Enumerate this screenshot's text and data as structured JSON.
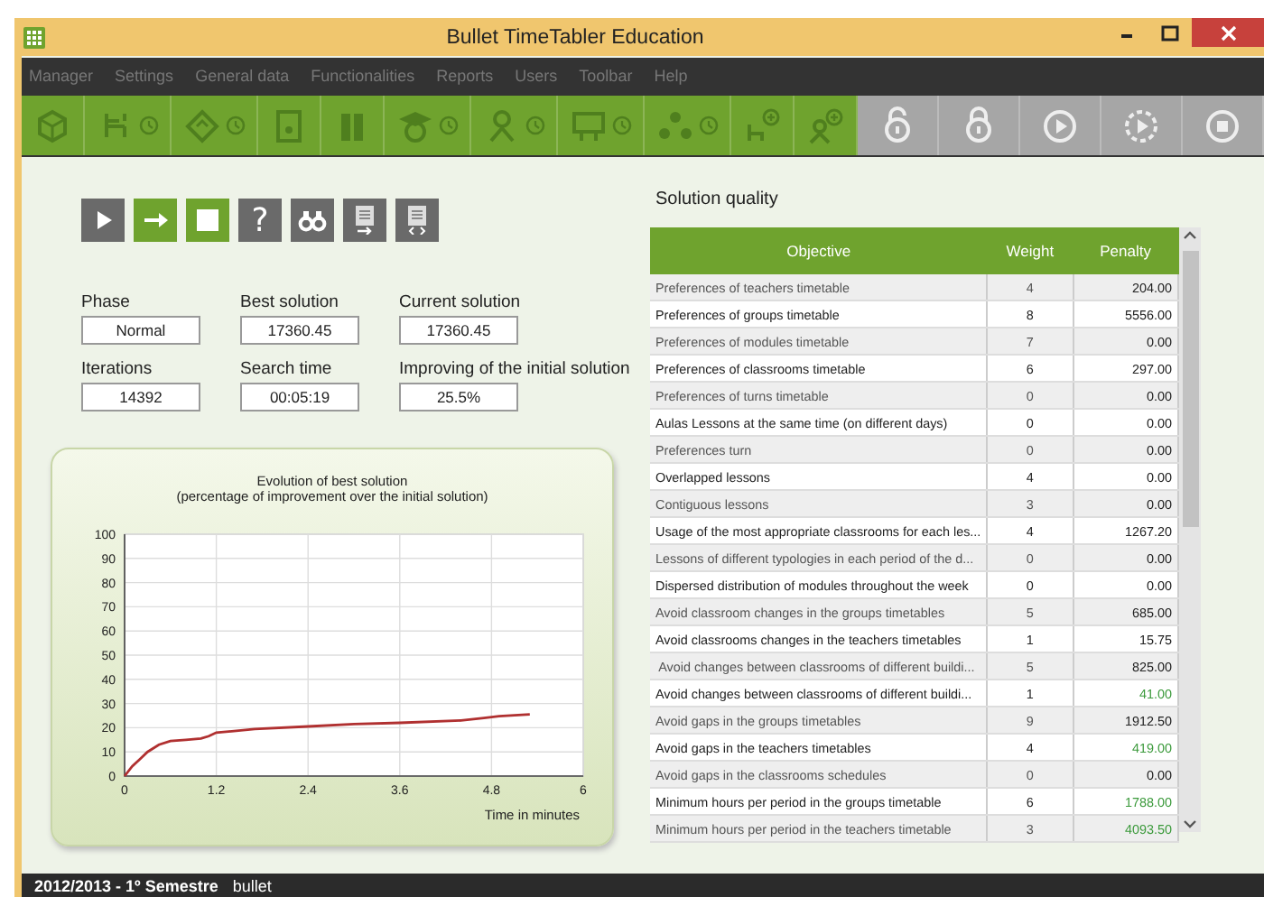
{
  "window": {
    "title": "Bullet TimeTabler Education"
  },
  "menu": [
    "Manager",
    "Settings",
    "General data",
    "Functionalities",
    "Reports",
    "Users",
    "Toolbar",
    "Help"
  ],
  "toolbar": [
    {
      "kind": "cube",
      "clock": false,
      "disabled": false
    },
    {
      "kind": "chair",
      "clock": true,
      "disabled": false
    },
    {
      "kind": "book",
      "clock": true,
      "disabled": false
    },
    {
      "kind": "certificate",
      "clock": false,
      "disabled": false
    },
    {
      "kind": "books",
      "clock": false,
      "disabled": false
    },
    {
      "kind": "graduate",
      "clock": true,
      "disabled": false
    },
    {
      "kind": "teacher",
      "clock": true,
      "disabled": false
    },
    {
      "kind": "board",
      "clock": true,
      "disabled": false
    },
    {
      "kind": "group",
      "clock": true,
      "disabled": false
    },
    {
      "kind": "add-chair",
      "clock": false,
      "disabled": false
    },
    {
      "kind": "add-person",
      "clock": false,
      "disabled": false
    },
    {
      "kind": "unlock",
      "clock": false,
      "disabled": true
    },
    {
      "kind": "lock",
      "clock": false,
      "disabled": true
    },
    {
      "kind": "play",
      "clock": false,
      "disabled": true
    },
    {
      "kind": "play-dashed",
      "clock": false,
      "disabled": true
    },
    {
      "kind": "stop",
      "clock": false,
      "disabled": true
    }
  ],
  "controls": [
    {
      "kind": "play",
      "active": false
    },
    {
      "kind": "arrow",
      "active": true
    },
    {
      "kind": "stop",
      "active": true
    },
    {
      "kind": "text",
      "label": "?",
      "active": false
    },
    {
      "kind": "binoculars",
      "active": false
    },
    {
      "kind": "export",
      "active": false
    },
    {
      "kind": "code",
      "active": false
    }
  ],
  "fields": [
    {
      "label": "Phase",
      "value": "Normal"
    },
    {
      "label": "Best solution",
      "value": "17360.45"
    },
    {
      "label": "Current solution",
      "value": "17360.45"
    },
    {
      "label": "Iterations",
      "value": "14392"
    },
    {
      "label": "Search time",
      "value": "00:05:19"
    },
    {
      "label": "Improving of the initial solution",
      "value": "25.5%"
    }
  ],
  "chart": {
    "chart_data": {
      "type": "line",
      "title": "Evolution of best solution\n(percentage of improvement over the initial solution)",
      "xlabel": "Time in minutes",
      "xlim": [
        0,
        6
      ],
      "ylim": [
        0,
        100
      ],
      "xticks": [
        0,
        1.2,
        2.4,
        3.6,
        4.8,
        6
      ],
      "yticks": [
        0,
        10,
        20,
        30,
        40,
        50,
        60,
        70,
        80,
        90,
        100
      ],
      "x": [
        0,
        0.1,
        0.2,
        0.3,
        0.45,
        0.6,
        0.8,
        1.0,
        1.1,
        1.2,
        1.4,
        1.7,
        2.4,
        3.0,
        3.6,
        4.4,
        4.7,
        4.9,
        5.3
      ],
      "grid": true,
      "series": [
        {
          "color": "#b03030",
          "values": [
            0,
            4,
            7,
            10,
            13,
            14.5,
            15,
            15.5,
            16.5,
            18,
            18.5,
            19.5,
            20.5,
            21.5,
            22,
            23,
            24,
            24.8,
            25.5
          ]
        }
      ]
    }
  },
  "quality": {
    "title": "Solution quality",
    "columns": [
      "Objective",
      "Weight",
      "Penalty"
    ],
    "rows": [
      {
        "objective": "Preferences of teachers timetable",
        "weight": "4",
        "penalty": "204.00",
        "color": "#222222"
      },
      {
        "objective": "Preferences of groups timetable",
        "weight": "8",
        "penalty": "5556.00",
        "color": "#222222"
      },
      {
        "objective": "Preferences of modules timetable",
        "weight": "7",
        "penalty": "0.00",
        "color": "#222222"
      },
      {
        "objective": "Preferences of classrooms timetable",
        "weight": "6",
        "penalty": "297.00",
        "color": "#222222"
      },
      {
        "objective": "Preferences of turns timetable",
        "weight": "0",
        "penalty": "0.00",
        "color": "#222222"
      },
      {
        "objective": "Aulas Lessons at the same time (on different days)",
        "weight": "0",
        "penalty": "0.00",
        "color": "#222222"
      },
      {
        "objective": "Preferences turn",
        "weight": "0",
        "penalty": "0.00",
        "color": "#222222"
      },
      {
        "objective": "Overlapped lessons",
        "weight": "4",
        "penalty": "0.00",
        "color": "#222222"
      },
      {
        "objective": "Contiguous lessons",
        "weight": "3",
        "penalty": "0.00",
        "color": "#222222"
      },
      {
        "objective": "Usage of the most appropriate classrooms for each les...",
        "weight": "4",
        "penalty": "1267.20",
        "color": "#222222"
      },
      {
        "objective": "Lessons of different typologies in each period of the d...",
        "weight": "0",
        "penalty": "0.00",
        "color": "#222222"
      },
      {
        "objective": "Dispersed distribution of modules throughout the week",
        "weight": "0",
        "penalty": "0.00",
        "color": "#222222"
      },
      {
        "objective": "Avoid classroom changes in the groups timetables",
        "weight": "5",
        "penalty": "685.00",
        "color": "#222222"
      },
      {
        "objective": "Avoid classrooms changes in the teachers timetables",
        "weight": "1",
        "penalty": "15.75",
        "color": "#222222"
      },
      {
        "objective": " Avoid changes between classrooms of different buildi...",
        "weight": "5",
        "penalty": "825.00",
        "color": "#222222"
      },
      {
        "objective": "Avoid changes between classrooms of different buildi...",
        "weight": "1",
        "penalty": "41.00",
        "color": "#3c9a3c"
      },
      {
        "objective": "Avoid gaps in the groups timetables",
        "weight": "9",
        "penalty": "1912.50",
        "color": "#222222"
      },
      {
        "objective": "Avoid gaps in the teachers timetables",
        "weight": "4",
        "penalty": "419.00",
        "color": "#3c9a3c"
      },
      {
        "objective": "Avoid gaps in the classrooms schedules",
        "weight": "0",
        "penalty": "0.00",
        "color": "#222222"
      },
      {
        "objective": "Minimum hours per period in the groups timetable",
        "weight": "6",
        "penalty": "1788.00",
        "color": "#3c9a3c"
      },
      {
        "objective": "Minimum hours per period in the teachers timetable",
        "weight": "3",
        "penalty": "4093.50",
        "color": "#3c9a3c"
      }
    ]
  },
  "status_bar": {
    "period": "2012/2013 - 1º Semestre",
    "user": "bullet"
  }
}
